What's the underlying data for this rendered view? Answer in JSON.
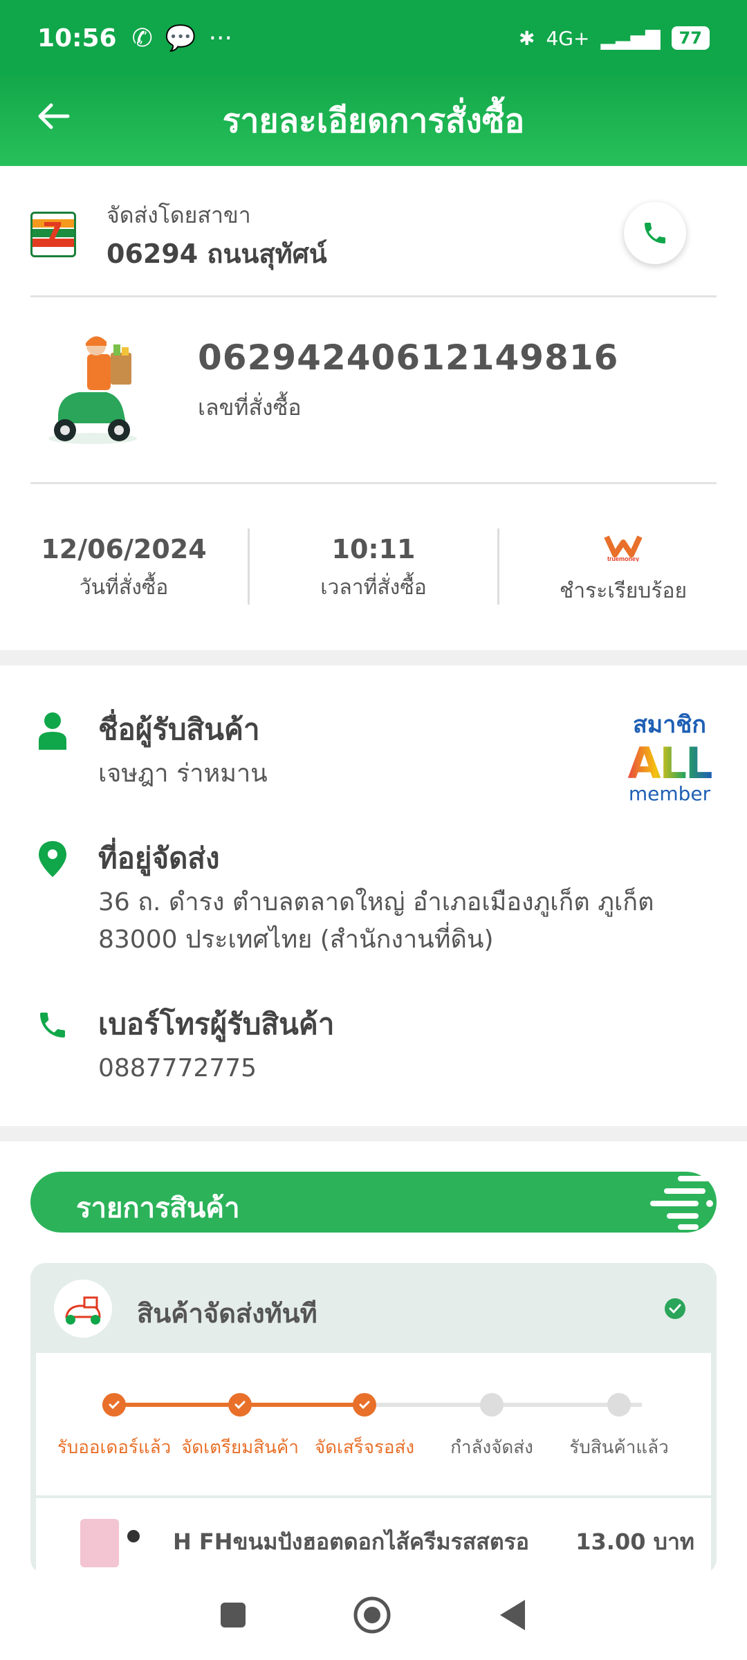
{
  "status_bar": {
    "time": "10:56",
    "battery": "77",
    "network": "4G+"
  },
  "header": {
    "title": "รายละเอียดการสั่งซื้อ"
  },
  "branch": {
    "label": "จัดส่งโดยสาขา",
    "name": "06294 ถนนสุทัศน์"
  },
  "order": {
    "number": "06294240612149816",
    "number_label": "เลขที่สั่งซื้อ"
  },
  "meta": {
    "date": "12/06/2024",
    "date_label": "วันที่สั่งซื้อ",
    "time": "10:11",
    "time_label": "เวลาที่สั่งซื้อ",
    "payment_brand": "truemoney",
    "payment_label": "ชำระเรียบร้อย"
  },
  "recipient": {
    "name_heading": "ชื่อผู้รับสินค้า",
    "name": "เจษฎา ร่าหมาน",
    "address_heading": "ที่อยู่จัดส่ง",
    "address_line1": "36 ถ. ดำรง ตำบลตลาดใหญ่ อำเภอเมืองภูเก็ต ภูเก็ต",
    "address_line2": "83000 ประเทศไทย (สำนักงานที่ดิน)",
    "phone_heading": "เบอร์โทรผู้รับสินค้า",
    "phone": "0887772775"
  },
  "member_badge": {
    "line1": "สมาชิก",
    "line2": "ALL",
    "line3": "member"
  },
  "items": {
    "banner": "รายการสินค้า",
    "card_title": "สินค้าจัดส่งทันที",
    "steps": [
      {
        "label": "รับออเดอร์แล้ว",
        "done": true
      },
      {
        "label": "จัดเตรียมสินค้า",
        "done": true
      },
      {
        "label": "จัดเสร็จรอส่ง",
        "done": true
      },
      {
        "label": "กำลังจัดส่ง",
        "done": false
      },
      {
        "label": "รับสินค้าแล้ว",
        "done": false
      }
    ],
    "product_name": "H FHขนมปังฮอตดอกไส้ครีมรสสตรอ",
    "product_price": "13.00 บาท"
  },
  "colors": {
    "brand_green": "#10a64a",
    "accent_orange": "#e8702a",
    "inactive": "#cfcfcf"
  }
}
